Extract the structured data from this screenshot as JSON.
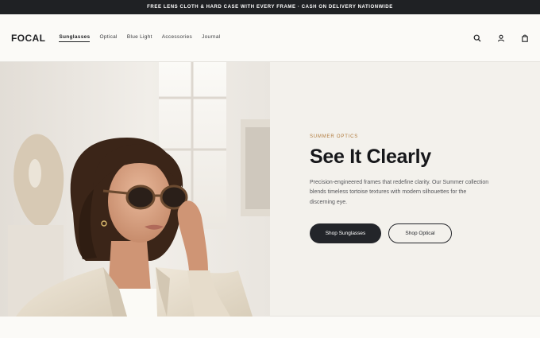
{
  "announcement": {
    "text": "FREE LENS CLOTH & HARD CASE WITH EVERY FRAME · CASH ON DELIVERY NATIONWIDE"
  },
  "header": {
    "logo": "FOCAL",
    "nav": [
      {
        "label": "Sunglasses",
        "active": true
      },
      {
        "label": "Optical"
      },
      {
        "label": "Blue Light"
      },
      {
        "label": "Accessories"
      },
      {
        "label": "Journal"
      }
    ],
    "icons": [
      "search-icon",
      "account-icon",
      "bag-icon"
    ]
  },
  "hero": {
    "eyebrow": "SUMMER OPTICS",
    "headline": "See It Clearly",
    "body": "Precision-engineered frames that redefine clarity. Our Summer collection blends timeless tortoise textures with modern silhouettes for the discerning eye.",
    "primary_cta": "Shop Sunglasses",
    "secondary_cta": "Shop Optical"
  },
  "colors": {
    "accent": "#b07a3c",
    "dark": "#23252a",
    "background": "#f7f6f2"
  }
}
